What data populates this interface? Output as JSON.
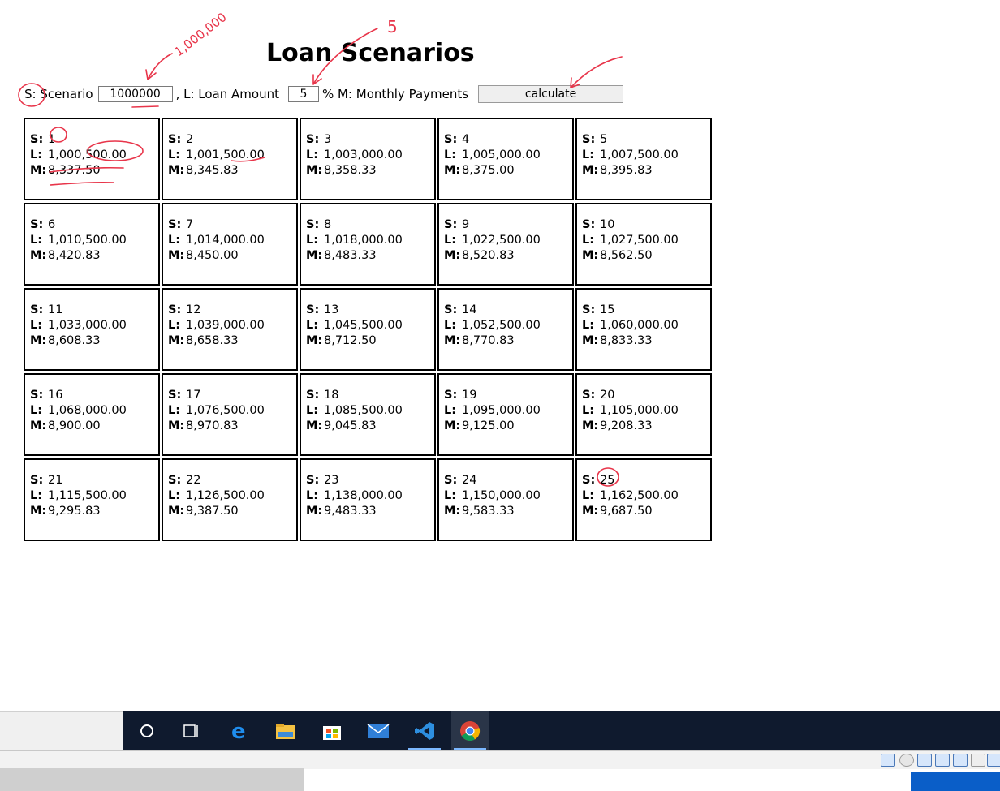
{
  "page": {
    "title": "Loan Scenarios"
  },
  "controls": {
    "scenario_label": "S: Scenario",
    "amount_value": "1000000",
    "loan_label": ", L: Loan Amount",
    "rate_value": "5",
    "monthly_label": "% M: Monthly Payments",
    "calculate_label": "calculate"
  },
  "labels": {
    "s": "S:",
    "l": "L:",
    "m": "M:"
  },
  "scenarios": [
    {
      "s": "1",
      "l": "1,000,500.00",
      "m": "8,337.50"
    },
    {
      "s": "2",
      "l": "1,001,500.00",
      "m": "8,345.83"
    },
    {
      "s": "3",
      "l": "1,003,000.00",
      "m": "8,358.33"
    },
    {
      "s": "4",
      "l": "1,005,000.00",
      "m": "8,375.00"
    },
    {
      "s": "5",
      "l": "1,007,500.00",
      "m": "8,395.83"
    },
    {
      "s": "6",
      "l": "1,010,500.00",
      "m": "8,420.83"
    },
    {
      "s": "7",
      "l": "1,014,000.00",
      "m": "8,450.00"
    },
    {
      "s": "8",
      "l": "1,018,000.00",
      "m": "8,483.33"
    },
    {
      "s": "9",
      "l": "1,022,500.00",
      "m": "8,520.83"
    },
    {
      "s": "10",
      "l": "1,027,500.00",
      "m": "8,562.50"
    },
    {
      "s": "11",
      "l": "1,033,000.00",
      "m": "8,608.33"
    },
    {
      "s": "12",
      "l": "1,039,000.00",
      "m": "8,658.33"
    },
    {
      "s": "13",
      "l": "1,045,500.00",
      "m": "8,712.50"
    },
    {
      "s": "14",
      "l": "1,052,500.00",
      "m": "8,770.83"
    },
    {
      "s": "15",
      "l": "1,060,000.00",
      "m": "8,833.33"
    },
    {
      "s": "16",
      "l": "1,068,000.00",
      "m": "8,900.00"
    },
    {
      "s": "17",
      "l": "1,076,500.00",
      "m": "8,970.83"
    },
    {
      "s": "18",
      "l": "1,085,500.00",
      "m": "9,045.83"
    },
    {
      "s": "19",
      "l": "1,095,000.00",
      "m": "9,125.00"
    },
    {
      "s": "20",
      "l": "1,105,000.00",
      "m": "9,208.33"
    },
    {
      "s": "21",
      "l": "1,115,500.00",
      "m": "9,295.83"
    },
    {
      "s": "22",
      "l": "1,126,500.00",
      "m": "9,387.50"
    },
    {
      "s": "23",
      "l": "1,138,000.00",
      "m": "9,483.33"
    },
    {
      "s": "24",
      "l": "1,150,000.00",
      "m": "9,583.33"
    },
    {
      "s": "25",
      "l": "1,162,500.00",
      "m": "9,687.50"
    }
  ],
  "annotations": {
    "amount_note": "1,000,000",
    "rate_note": "5",
    "ink_color": "#e8354a"
  },
  "taskbar": {
    "icons": [
      "cortana-icon",
      "task-view-icon",
      "edge-icon",
      "file-explorer-icon",
      "store-icon",
      "mail-icon",
      "vscode-icon",
      "chrome-icon"
    ],
    "active": "chrome-icon"
  }
}
